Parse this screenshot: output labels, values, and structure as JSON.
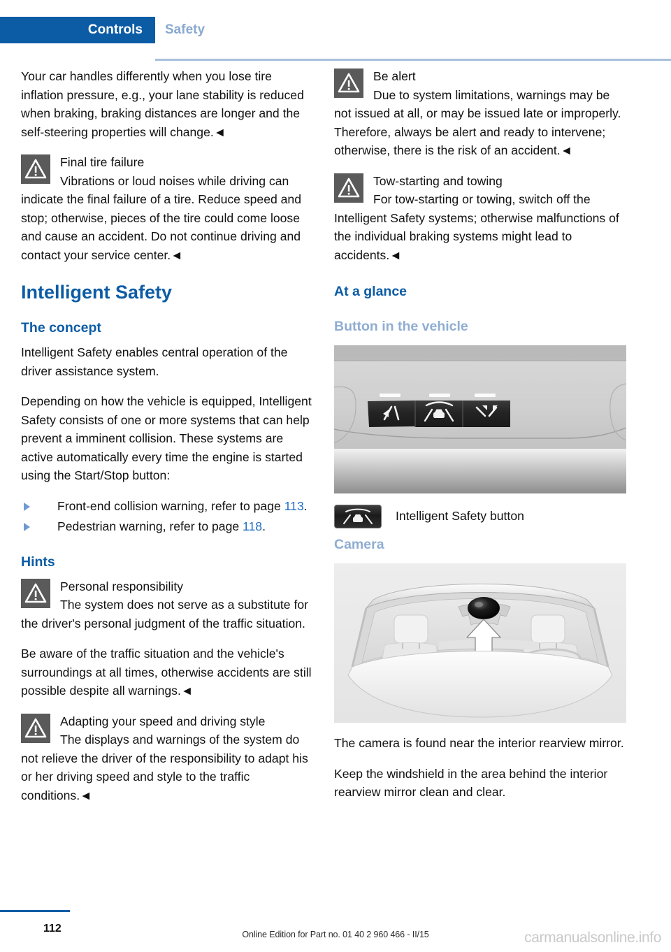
{
  "header": {
    "active_tab": "Controls",
    "inactive_tab": "Safety"
  },
  "left_column": {
    "intro_paragraph": "Your car handles differently when you lose tire inflation pressure, e.g., your lane stability is reduced when braking, braking distances are longer and the self-steering properties will change.◄",
    "warning_final_tire": {
      "icon": "warning-triangle-icon",
      "title": "Final tire failure",
      "text": "Vibrations or loud noises while driving can indicate the final failure of a tire. Reduce speed and stop; otherwise, pieces of the tire could come loose and cause an accident. Do not continue driving and contact your service center.◄"
    },
    "main_heading": "Intelligent Safety",
    "concept_heading": "The concept",
    "concept_p1": "Intelligent Safety enables central operation of the driver assistance system.",
    "concept_p2": "Depending on how the vehicle is equipped, Intelligent Safety consists of one or more systems that can help prevent a imminent collision. These systems are active automatically every time the engine is started using the Start/Stop button:",
    "bullets": [
      {
        "text_before": "Front-end collision warning, refer to page ",
        "page": "113",
        "text_after": "."
      },
      {
        "text_before": "Pedestrian warning, refer to page ",
        "page": "118",
        "text_after": "."
      }
    ],
    "hints_heading": "Hints",
    "warning_personal": {
      "icon": "warning-triangle-icon",
      "title": "Personal responsibility",
      "text": "The system does not serve as a substitute for the driver's personal judgment of the traffic situation."
    },
    "aware_paragraph": "Be aware of the traffic situation and the vehicle's surroundings at all times, otherwise accidents are still possible despite all warnings.◄",
    "warning_adapting": {
      "icon": "warning-triangle-icon",
      "title": "Adapting your speed and driving style",
      "text": "The displays and warnings of the system do not relieve the driver of the responsibility to adapt his or her driving speed and style to the traffic conditions.◄"
    }
  },
  "right_column": {
    "warning_be_alert": {
      "icon": "warning-triangle-icon",
      "title": "Be alert",
      "text": "Due to system limitations, warnings may be not issued at all, or may be issued late or improperly. Therefore, always be alert and ready to intervene; otherwise, there is the risk of an accident.◄"
    },
    "warning_tow": {
      "icon": "warning-triangle-icon",
      "title": "Tow-starting and towing",
      "text": "For tow-starting or towing, switch off the Intelligent Safety systems; otherwise malfunctions of the individual braking systems might lead to accidents.◄"
    },
    "at_a_glance_heading": "At a glance",
    "button_in_vehicle_heading": "Button in the vehicle",
    "figure_button_alt": "vehicle-console-buttons-photo",
    "button_caption": "Intelligent Safety button",
    "button_caption_icon": "intelligent-safety-button-icon",
    "camera_heading": "Camera",
    "figure_camera_alt": "windshield-camera-location-illustration",
    "camera_p1": "The camera is found near the interior rearview mirror.",
    "camera_p2": "Keep the windshield in the area behind the interior rearview mirror clean and clear."
  },
  "footer": {
    "page_number": "112",
    "edition_text": "Online Edition for Part no. 01 40 2 960 466 - II/15",
    "watermark": "carmanualsonline.info"
  },
  "colors": {
    "brand_blue": "#0c5ca5",
    "light_blue": "#8fadd2",
    "link_blue": "#1f6fc4",
    "warning_icon_bg": "#5a5a5a"
  }
}
